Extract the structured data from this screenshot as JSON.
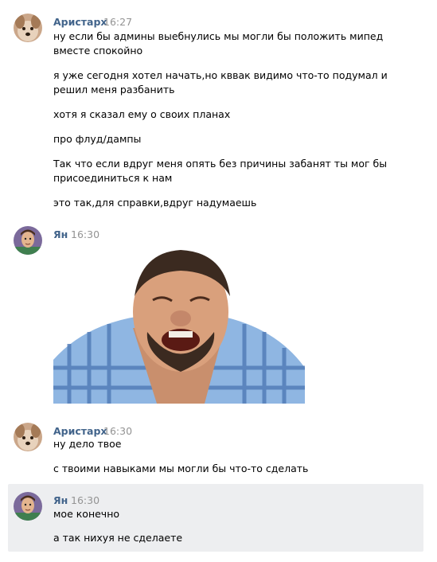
{
  "messages": [
    {
      "author": "Аристарх",
      "time": "16:27",
      "avatar_icon": "dog-avatar-icon",
      "paragraphs": [
        [
          "ну если бы админы выебнулись мы могли бы положить мипед",
          "вместе спокойно"
        ],
        [
          "я уже сегодня хотел начать,но кввак видимо что-то подумал и",
          "решил меня разбанить"
        ],
        [
          "хотя я сказал ему о своих планах"
        ],
        [
          "про флуд/дампы"
        ],
        [
          "Так что если вдруг меня опять без причины забанят ты мог бы",
          "присоединиться к нам"
        ],
        [
          "это так,для справки,вдруг надумаешь"
        ]
      ]
    },
    {
      "author": "Ян",
      "time": "16:30",
      "avatar_icon": "cartoon-man-avatar-icon",
      "attachment": "laughing-man-photo"
    },
    {
      "author": "Аристарх",
      "time": "16:30",
      "avatar_icon": "dog-avatar-icon",
      "paragraphs": [
        [
          "ну дело твое"
        ],
        [
          "с твоими навыками мы могли бы что-то сделать"
        ]
      ]
    },
    {
      "author": "Ян",
      "time": "16:30",
      "avatar_icon": "cartoon-man-avatar-icon",
      "highlighted": true,
      "paragraphs": [
        [
          "мое конечно"
        ],
        [
          "а так нихуя не сделаете"
        ]
      ]
    }
  ],
  "colors": {
    "author": "#42648b",
    "time": "#939393",
    "highlight_bg": "#edeef0",
    "text": "#000000"
  }
}
